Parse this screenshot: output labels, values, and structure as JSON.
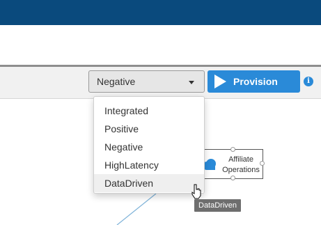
{
  "toolbar": {
    "scenario_select": {
      "selected": "Negative",
      "options": [
        "Integrated",
        "Positive",
        "Negative",
        "HighLatency",
        "DataDriven"
      ]
    },
    "provision_label": "Provision",
    "info_glyph": "i"
  },
  "dropdown": {
    "items": [
      {
        "label": "Integrated"
      },
      {
        "label": "Positive"
      },
      {
        "label": "Negative"
      },
      {
        "label": "HighLatency"
      },
      {
        "label": "DataDriven"
      }
    ],
    "hovered": "DataDriven"
  },
  "canvas": {
    "node": {
      "label_line1": "Affiliate",
      "label_line2": "Operations",
      "icon": "cloud-icon",
      "icon_color": "#2a8ad8"
    }
  },
  "tooltip": {
    "text": "DataDriven"
  },
  "colors": {
    "header": "#0a4a7d",
    "accent": "#2a8ad8",
    "tooltip_bg": "#6e6e6e"
  }
}
